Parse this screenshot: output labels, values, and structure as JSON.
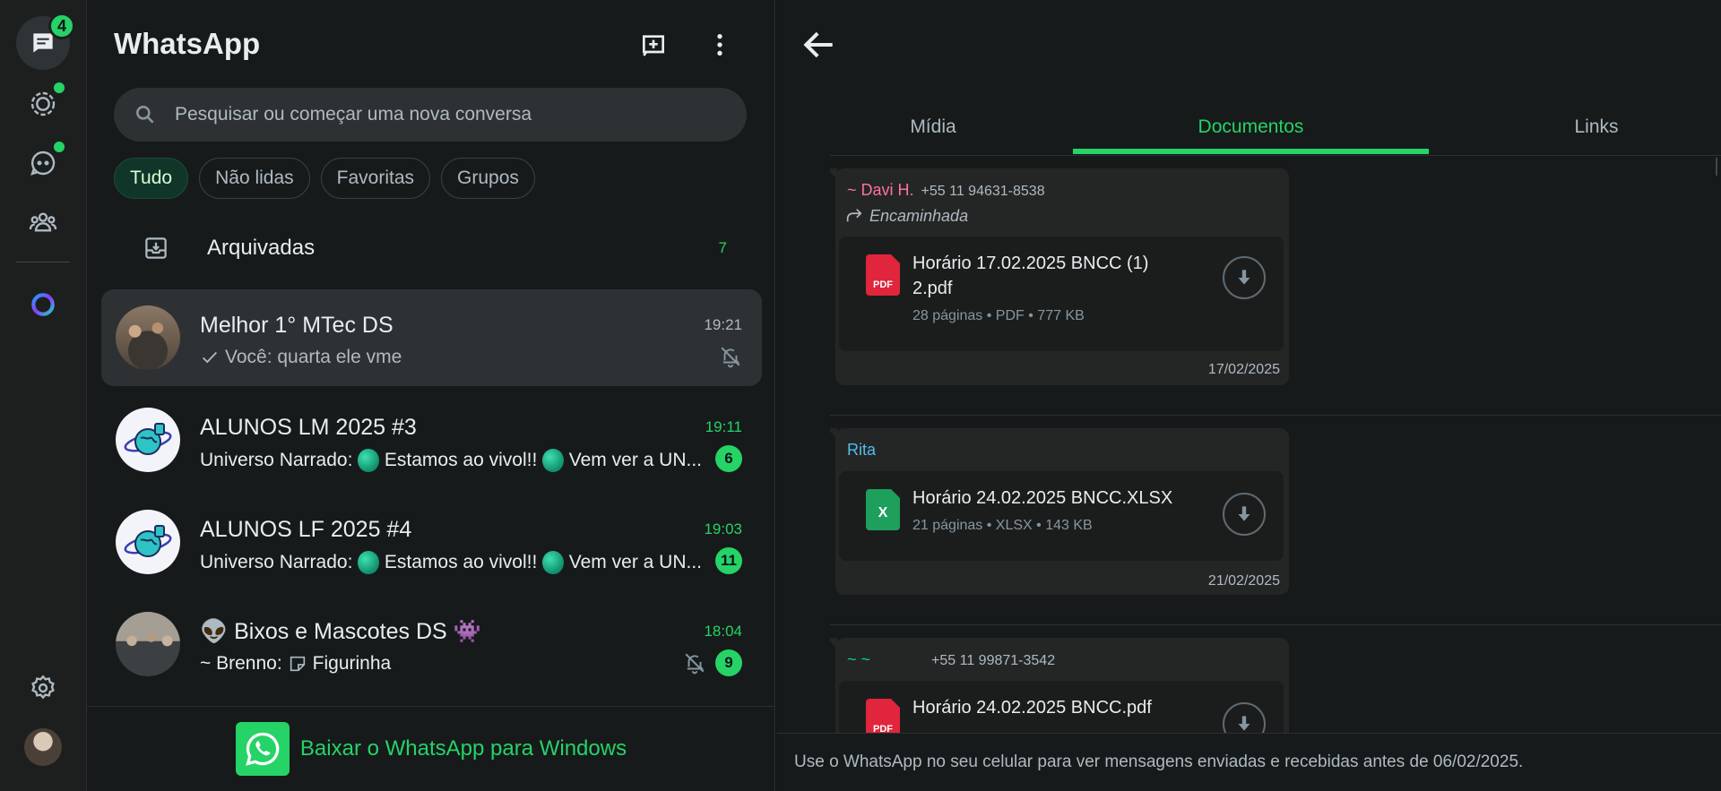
{
  "rail": {
    "chats_badge": "4",
    "colors": {
      "accent": "#25d366"
    }
  },
  "list": {
    "title": "WhatsApp",
    "search_placeholder": "Pesquisar ou começar uma nova conversa",
    "filters": [
      "Tudo",
      "Não lidas",
      "Favoritas",
      "Grupos"
    ],
    "archived": {
      "label": "Arquivadas",
      "count": "7"
    },
    "chats": [
      {
        "name": "Melhor 1° MTec DS",
        "time": "19:21",
        "preview": "Você: quarta ele vme",
        "muted": true
      },
      {
        "name": "ALUNOS LM 2025 #3",
        "time": "19:11",
        "preview_sender": "Universo Narrado:",
        "preview_a": "Estamos ao vivol!!",
        "preview_b": "Vem ver a UN...",
        "unread": "6"
      },
      {
        "name": "ALUNOS LF 2025 #4",
        "time": "19:03",
        "preview_sender": "Universo Narrado:",
        "preview_a": "Estamos ao vivol!!",
        "preview_b": "Vem ver a UN...",
        "unread": "11"
      },
      {
        "name_emoji_left": "👽",
        "name": "Bixos e Mascotes DS",
        "name_emoji_right": "👾",
        "time": "18:04",
        "preview_sender": "~ Brenno:",
        "preview": "Figurinha",
        "unread": "9",
        "muted": true
      }
    ],
    "download_cta": "Baixar o WhatsApp para Windows"
  },
  "media": {
    "tabs": [
      "Mídia",
      "Documentos",
      "Links"
    ],
    "active_tab": "Documentos",
    "documents": [
      {
        "sender": "~ Davi H.",
        "phone": "+55 11 94631-8538",
        "sender_color": "#ff72a1",
        "forwarded": "Encaminhada",
        "file_name": "Horário 17.02.2025 BNCC (1) 2.pdf",
        "file_type": "PDF",
        "pages": "28 páginas",
        "format": "PDF",
        "size": "777 KB",
        "date": "17/02/2025"
      },
      {
        "sender": "Rita",
        "phone": "",
        "sender_color": "#53bdeb",
        "file_name": "Horário 24.02.2025 BNCC.XLSX",
        "file_type": "X",
        "pages": "21 páginas",
        "format": "XLSX",
        "size": "143 KB",
        "date": "21/02/2025"
      },
      {
        "sender": "~ ~",
        "phone": "+55 11 99871-3542",
        "sender_color": "#06cf9c",
        "file_name": "Horário 24.02.2025 BNCC.pdf",
        "file_type": "PDF"
      }
    ],
    "footer": "Use o WhatsApp no seu celular para ver mensagens enviadas e recebidas antes de 06/02/2025."
  }
}
